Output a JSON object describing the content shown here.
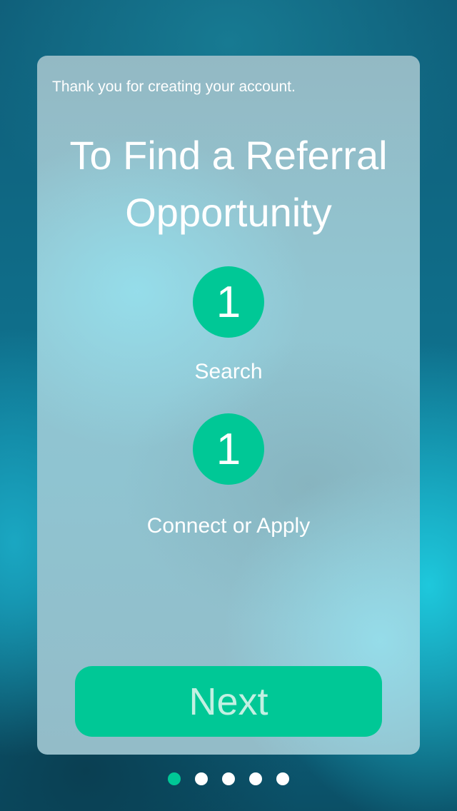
{
  "card": {
    "thanks_text": "Thank you for creating your account.",
    "headline_line1": "To Find a Referral",
    "headline_line2": "Opportunity",
    "steps": [
      {
        "number": "1",
        "label": "Search"
      },
      {
        "number": "1",
        "label": "Connect or Apply"
      }
    ],
    "next_label": "Next"
  },
  "pagination": {
    "total_pages": 5,
    "active_page": 1
  },
  "colors": {
    "accent": "#00c896",
    "text": "#ffffff",
    "button_text": "#c2f0e2"
  }
}
